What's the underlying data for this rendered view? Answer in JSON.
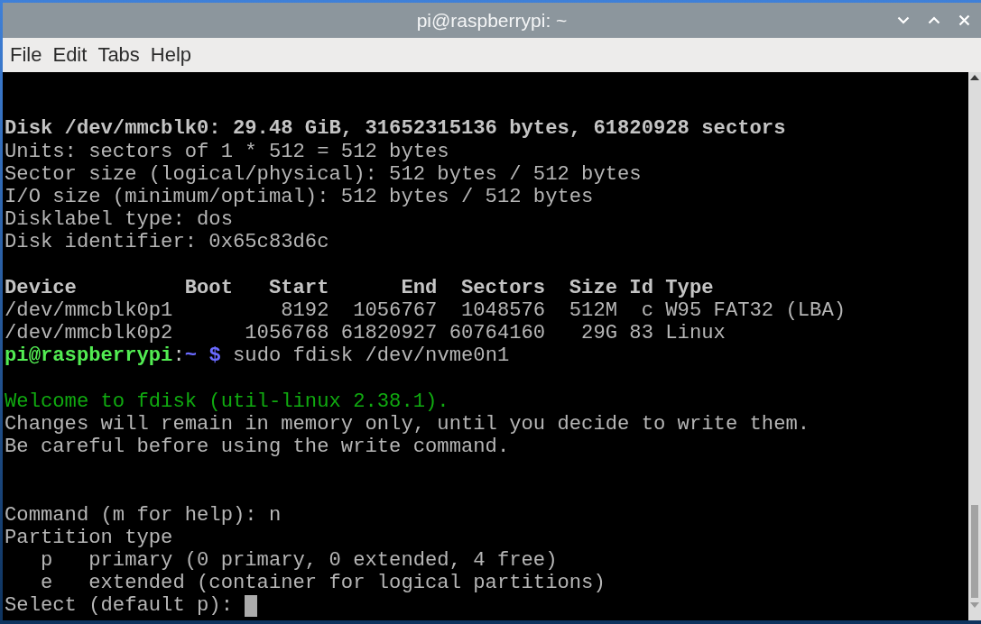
{
  "window": {
    "title": "pi@raspberrypi: ~"
  },
  "menu_bar": {
    "items": [
      "File",
      "Edit",
      "Tabs",
      "Help"
    ]
  },
  "terminal": {
    "cursor": true,
    "lines": [
      {
        "kind": "blank"
      },
      {
        "kind": "blank"
      },
      {
        "kind": "bold",
        "text": "Disk /dev/mmcblk0: 29.48 GiB, 31652315136 bytes, 61820928 sectors"
      },
      {
        "kind": "output",
        "text": "Units: sectors of 1 * 512 = 512 bytes"
      },
      {
        "kind": "output",
        "text": "Sector size (logical/physical): 512 bytes / 512 bytes"
      },
      {
        "kind": "output",
        "text": "I/O size (minimum/optimal): 512 bytes / 512 bytes"
      },
      {
        "kind": "output",
        "text": "Disklabel type: dos"
      },
      {
        "kind": "output",
        "text": "Disk identifier: 0x65c83d6c"
      },
      {
        "kind": "blank"
      },
      {
        "kind": "bold",
        "text": "Device         Boot   Start      End  Sectors  Size Id Type"
      },
      {
        "kind": "output",
        "text": "/dev/mmcblk0p1         8192  1056767  1048576  512M  c W95 FAT32 (LBA)"
      },
      {
        "kind": "output",
        "text": "/dev/mmcblk0p2      1056768 61820927 60764160   29G 83 Linux"
      },
      {
        "kind": "prompt",
        "user_host": "pi@raspberrypi",
        "separator": ":",
        "path": "~",
        "symbol": "$",
        "command": "sudo fdisk /dev/nvme0n1"
      },
      {
        "kind": "blank"
      },
      {
        "kind": "info",
        "text": "Welcome to fdisk (util-linux 2.38.1)."
      },
      {
        "kind": "output",
        "text": "Changes will remain in memory only, until you decide to write them."
      },
      {
        "kind": "output",
        "text": "Be careful before using the write command."
      },
      {
        "kind": "blank"
      },
      {
        "kind": "blank"
      },
      {
        "kind": "output",
        "text": "Command (m for help): n"
      },
      {
        "kind": "output",
        "text": "Partition type"
      },
      {
        "kind": "output",
        "text": "   p   primary (0 primary, 0 extended, 4 free)"
      },
      {
        "kind": "output",
        "text": "   e   extended (container for logical partitions)"
      },
      {
        "kind": "output",
        "text": "Select (default p):"
      }
    ]
  }
}
